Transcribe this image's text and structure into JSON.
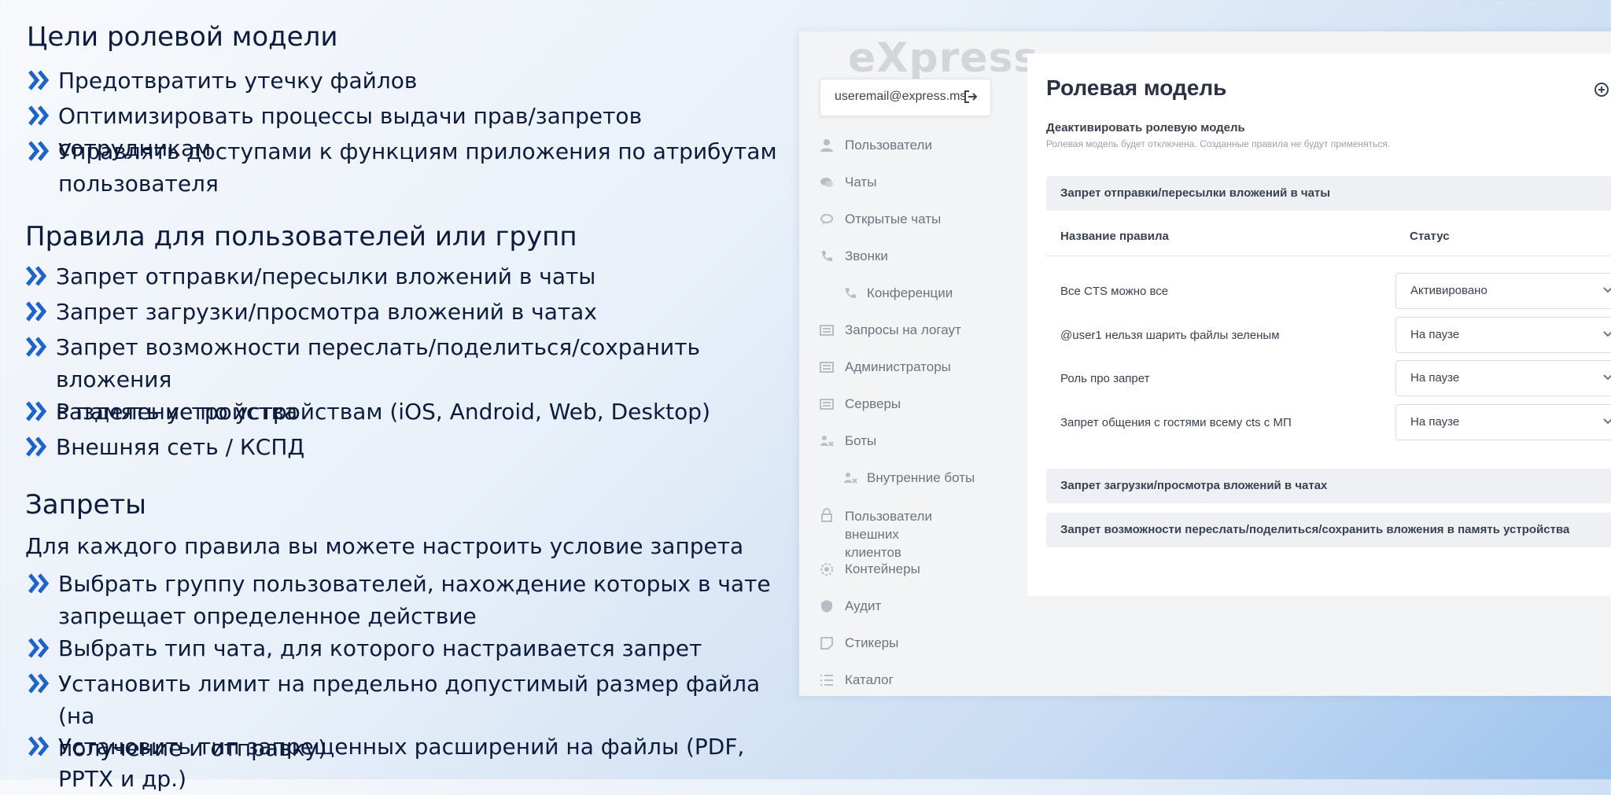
{
  "slide": {
    "sections": [
      {
        "title": "Цели ролевой модели",
        "bullets": [
          [
            "Предотвратить утечку файлов"
          ],
          [
            "Оптимизировать процессы выдачи прав/запретов сотрудникам"
          ],
          [
            "Управлять доступами к функциям приложения по атрибутам",
            "пользователя"
          ]
        ]
      },
      {
        "title": "Правила для пользователей или групп",
        "bullets": [
          [
            "Запрет отправки/пересылки вложений в чаты"
          ],
          [
            "Запрет загрузки/просмотра вложений в чатах"
          ],
          [
            "Запрет возможности переслать/поделиться/сохранить вложения",
            "в память устройства"
          ],
          [
            "Разделение по устройствам (iOS, Android, Web, Desktop)"
          ],
          [
            "Внешняя сеть / КСПД"
          ]
        ]
      },
      {
        "title": "Запреты",
        "intro": "Для каждого правила вы можете настроить условие запрета",
        "bullets": [
          [
            "Выбрать группу пользователей, нахождение которых в чате",
            "запрещает определенное действие"
          ],
          [
            "Выбрать тип чата, для которого настраивается запрет"
          ],
          [
            "Установить лимит на предельно допустимый размер файла (на",
            "получение и отправку)"
          ],
          [
            "Установить тип запрещенных расширений на файлы (PDF, PPTX и др.)"
          ]
        ]
      }
    ],
    "accent_color": "#1e64c8"
  },
  "app": {
    "logo": "eXpress",
    "user_email": "useremail@express.ms",
    "logout_icon": "logout-icon",
    "nav": [
      {
        "label": "Пользователи",
        "icon": "user-icon",
        "sub": false
      },
      {
        "label": "Чаты",
        "icon": "chat-icon",
        "sub": false
      },
      {
        "label": "Открытые чаты",
        "icon": "open-chat-icon",
        "sub": false
      },
      {
        "label": "Звонки",
        "icon": "phone-icon",
        "sub": false
      },
      {
        "label": "Конференции",
        "icon": "phone-icon",
        "sub": true
      },
      {
        "label": "Запросы на логаут",
        "icon": "list-icon",
        "sub": false
      },
      {
        "label": "Администраторы",
        "icon": "list-icon",
        "sub": false
      },
      {
        "label": "Серверы",
        "icon": "list-icon",
        "sub": false
      },
      {
        "label": "Боты",
        "icon": "bot-icon",
        "sub": false
      },
      {
        "label": "Внутренние боты",
        "icon": "bot-icon",
        "sub": true
      },
      {
        "label": "Пользователи внешних\nклиентов",
        "icon": "lock-icon",
        "sub": false
      },
      {
        "label": "Контейнеры",
        "icon": "gear-icon",
        "sub": false
      },
      {
        "label": "Аудит",
        "icon": "shield-icon",
        "sub": false
      },
      {
        "label": "Стикеры",
        "icon": "sticker-icon",
        "sub": false
      },
      {
        "label": "Каталог",
        "icon": "catalog-icon",
        "sub": false
      }
    ],
    "main": {
      "title": "Ролевая модель",
      "deactivate_title": "Деактивировать ролевую модель",
      "deactivate_desc": "Ролевая модель будет отключена. Созданные правила не будут применяться.",
      "section1": "Запрет отправки/пересылки вложений в чаты",
      "col_name": "Название правила",
      "col_status": "Статус",
      "rules": [
        {
          "name": "Все CTS можно все",
          "status": "Активировано"
        },
        {
          "name": "@user1 нельзя шарить файлы зеленым",
          "status": "На паузе"
        },
        {
          "name": "Роль про запрет",
          "status": "На паузе"
        },
        {
          "name": "Запрет общения с гостями всему cts с МП",
          "status": "На паузе"
        }
      ],
      "section2": "Запрет загрузки/просмотра вложений в чатах",
      "section3": "Запрет возможности переслать/поделиться/сохранить вложения в память устройства"
    }
  }
}
